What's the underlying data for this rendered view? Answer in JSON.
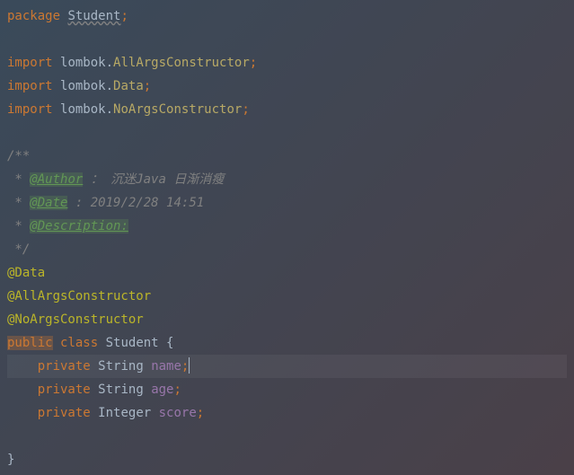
{
  "code": {
    "package_keyword": "package",
    "package_name": "Student",
    "import_keyword": "import",
    "import1_pkg": "lombok.",
    "import1_cls": "AllArgsConstructor",
    "import2_pkg": "lombok.",
    "import2_cls": "Data",
    "import3_pkg": "lombok.",
    "import3_cls": "NoArgsConstructor",
    "javadoc_start": "/**",
    "javadoc_star": " * ",
    "javadoc_author_tag": "@Author",
    "javadoc_author_text": " ： 沉迷Java 日渐消瘦",
    "javadoc_date_tag": "@Date",
    "javadoc_date_text": " : 2019/2/28 14:51",
    "javadoc_desc_tag": "@Description:",
    "javadoc_end": " */",
    "anno_data": "@Data",
    "anno_allargs": "@AllArgsConstructor",
    "anno_noargs": "@NoArgsConstructor",
    "public_keyword": "public",
    "class_keyword": "class",
    "class_name": "Student",
    "open_brace": " {",
    "private_keyword": "private",
    "type_string": "String",
    "type_integer": "Integer",
    "field_name": "name",
    "field_age": "age",
    "field_score": "score",
    "close_brace": "}",
    "semi": ";"
  }
}
